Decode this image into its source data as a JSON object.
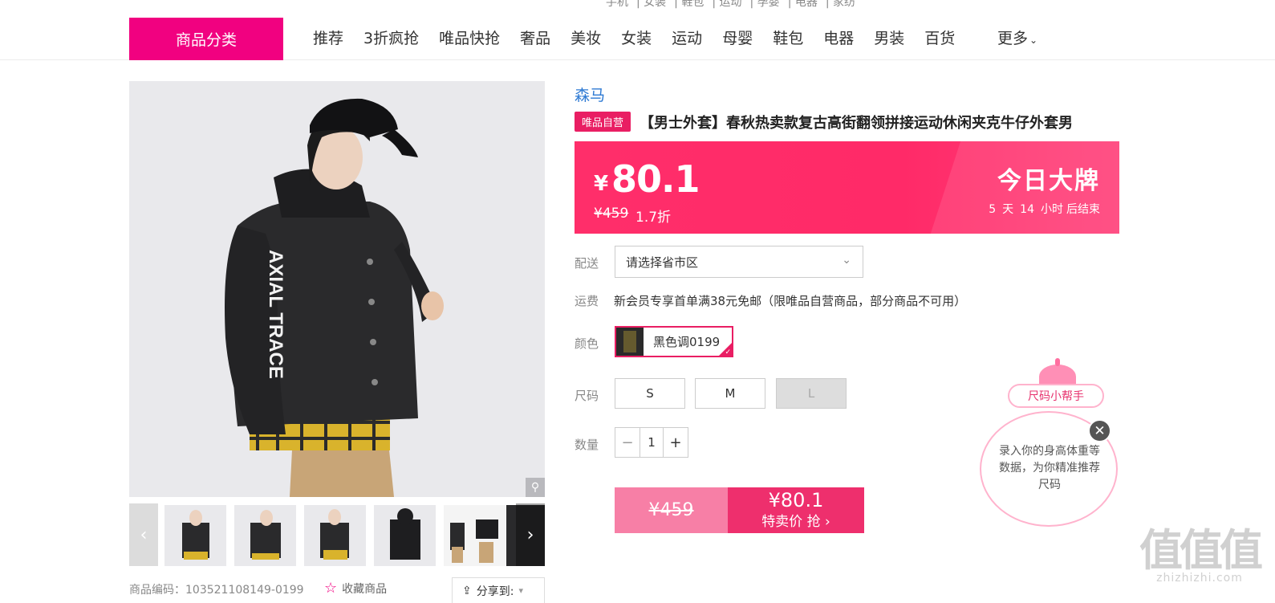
{
  "nav": {
    "category_label": "商品分类",
    "items": [
      "推荐",
      "3折疯抢",
      "唯品快抢",
      "奢品",
      "美妆",
      "女装",
      "运动",
      "母婴",
      "鞋包",
      "电器",
      "男装",
      "百货"
    ],
    "more_label": "更多",
    "top_links": [
      "手机",
      "女装",
      "鞋包",
      "运动",
      "孕婴",
      "电器",
      "家纺"
    ]
  },
  "product": {
    "brand": "森马",
    "self_operated_badge": "唯品自营",
    "title": "【男士外套】春秋热卖款复古高街翻领拼接运动休闲夹克牛仔外套男",
    "image_sleeve_text": "AXIAL TRACE"
  },
  "price_banner": {
    "currency": "¥",
    "price": "80.1",
    "original_price": "¥459",
    "discount": "1.7折",
    "promo_title": "今日大牌",
    "countdown_days": "5",
    "countdown_days_unit": "天",
    "countdown_hours": "14",
    "countdown_hours_unit": "小时",
    "countdown_suffix": "后结束"
  },
  "options": {
    "delivery_label": "配送",
    "region_placeholder": "请选择省市区",
    "shipping_label": "运费",
    "shipping_text": "新会员专享首单满38元免邮（限唯品自营商品，部分商品不可用）",
    "color_label": "颜色",
    "color_value": "黑色调0199",
    "size_label": "尺码",
    "sizes": [
      "S",
      "M",
      "L"
    ],
    "quantity_label": "数量",
    "quantity": "1"
  },
  "buy": {
    "original_price": "¥459",
    "sale_price": "¥80.1",
    "sale_label": "特卖价 抢"
  },
  "footer_info": {
    "sku_label": "商品编码：103521108149-0199",
    "favorite_label": "收藏商品",
    "share_label": "分享到:"
  },
  "size_helper": {
    "title": "尺码小帮手",
    "text": "录入你的身高体重等数据，为你精准推荐尺码"
  },
  "watermark": {
    "big": "值值值",
    "small": "zhizhizhi.com"
  },
  "colors": {
    "brand_pink": "#f10180",
    "banner_pink": "#ff2e6a",
    "link_blue": "#2e7ad3"
  }
}
